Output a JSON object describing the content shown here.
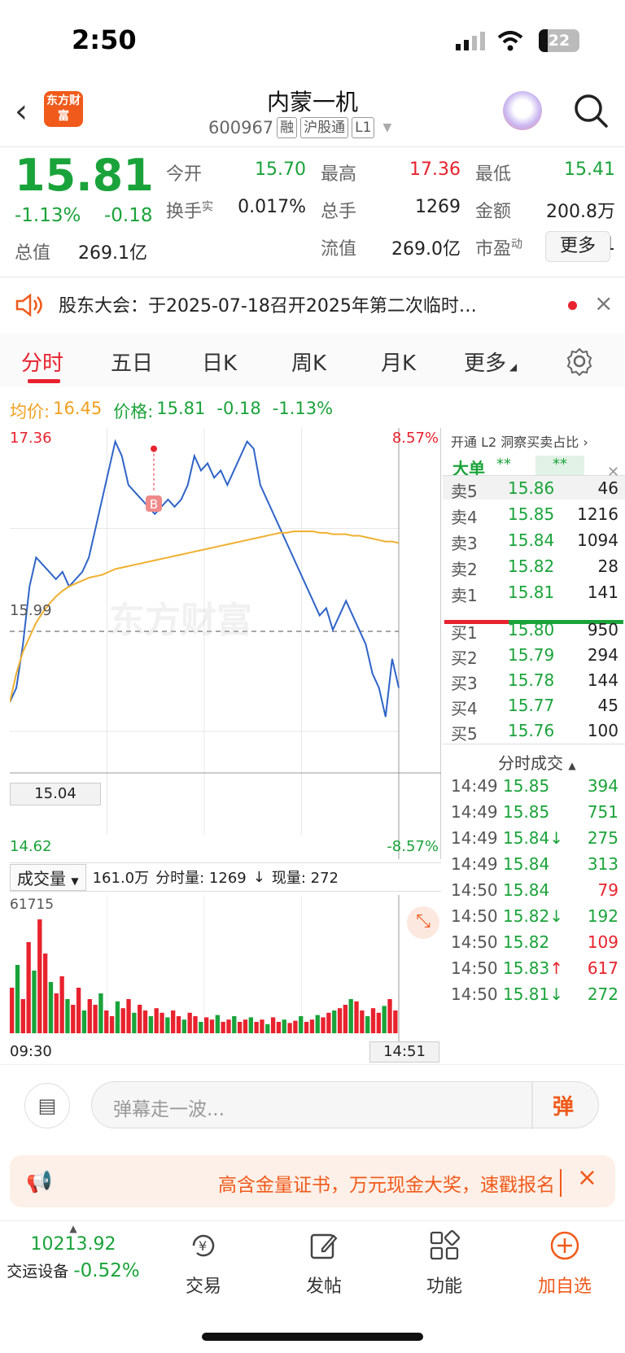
{
  "status_bar": {
    "time": "2:50",
    "battery": "22"
  },
  "header": {
    "logo_text": "东方财富",
    "title": "内蒙一机",
    "code": "600967",
    "tags": [
      "融",
      "沪股通",
      "L1"
    ]
  },
  "quote": {
    "price": "15.81",
    "change_pct": "-1.13%",
    "change": "-0.18",
    "fields": [
      {
        "label": "今开",
        "value": "15.70",
        "color": "green"
      },
      {
        "label": "最高",
        "value": "17.36",
        "color": "red"
      },
      {
        "label": "最低",
        "value": "15.41",
        "color": "green"
      },
      {
        "label": "换手",
        "sup": "实",
        "value": "0.017%",
        "color": "black"
      },
      {
        "label": "总手",
        "value": "1269",
        "color": "black"
      },
      {
        "label": "金额",
        "value": "200.8万",
        "color": "black"
      },
      {
        "label": "总值",
        "value": "269.1亿",
        "color": "black"
      },
      {
        "label": "流值",
        "value": "269.0亿",
        "color": "black"
      },
      {
        "label": "市盈",
        "sup": "动",
        "value": "36.11",
        "color": "black"
      }
    ],
    "more_label": "更多"
  },
  "notice": {
    "text": "股东大会：于2025-07-18召开2025年第二次临时…"
  },
  "tabs": [
    {
      "label": "分时",
      "active": true
    },
    {
      "label": "五日"
    },
    {
      "label": "日K"
    },
    {
      "label": "周K"
    },
    {
      "label": "月K"
    },
    {
      "label": "更多"
    }
  ],
  "avg_line": {
    "avg_label": "均价:",
    "avg_value": "16.45",
    "price_label": "价格:",
    "price_value": "15.81",
    "change": "-0.18",
    "change_pct": "-1.13%"
  },
  "chart_data": {
    "type": "line",
    "y_high": "17.36",
    "y_low": "14.62",
    "y_ref": "15.99",
    "pct_high": "8.57%",
    "pct_low": "-8.57%",
    "level_label": "15.04",
    "ylim": [
      14.62,
      17.36
    ],
    "watermark": "东方财富",
    "marker": "B",
    "x_start": "09:30",
    "x_end": "14:51",
    "series": [
      {
        "values": [
          15.5,
          15.6,
          15.9,
          16.3,
          16.5,
          16.45,
          16.4,
          16.35,
          16.4,
          16.3,
          16.35,
          16.4,
          16.5,
          16.7,
          16.9,
          17.1,
          17.3,
          17.2,
          17.0,
          16.95,
          16.9,
          16.85,
          16.8,
          16.85,
          16.9,
          16.85,
          16.9,
          17.0,
          17.2,
          17.1,
          17.15,
          17.05,
          17.1,
          17.0,
          17.1,
          17.2,
          17.3,
          17.25,
          17.0,
          16.9,
          16.8,
          16.7,
          16.6,
          16.5,
          16.4,
          16.3,
          16.2,
          16.1,
          16.15,
          16.0,
          16.1,
          16.2,
          16.1,
          16.0,
          15.9,
          15.7,
          15.6,
          15.4,
          15.8,
          15.6
        ]
      },
      {
        "values": [
          15.5,
          15.7,
          15.85,
          15.95,
          16.05,
          16.12,
          16.18,
          16.23,
          16.27,
          16.3,
          16.32,
          16.34,
          16.36,
          16.37,
          16.38,
          16.4,
          16.42,
          16.43,
          16.44,
          16.45,
          16.46,
          16.47,
          16.48,
          16.49,
          16.5,
          16.51,
          16.52,
          16.53,
          16.54,
          16.55,
          16.56,
          16.57,
          16.58,
          16.59,
          16.6,
          16.61,
          16.62,
          16.63,
          16.64,
          16.65,
          16.66,
          16.67,
          16.67,
          16.68,
          16.68,
          16.68,
          16.68,
          16.67,
          16.67,
          16.66,
          16.66,
          16.66,
          16.65,
          16.65,
          16.64,
          16.63,
          16.62,
          16.61,
          16.61,
          16.6
        ]
      }
    ],
    "volume": {
      "label": "成交量",
      "total": "161.0万",
      "fen_label": "分时量: 1269",
      "now_label": "现量: 272",
      "max": "61715",
      "values": [
        40,
        60,
        30,
        80,
        55,
        100,
        70,
        45,
        35,
        50,
        30,
        25,
        40,
        20,
        30,
        25,
        35,
        20,
        15,
        28,
        22,
        30,
        18,
        25,
        20,
        15,
        22,
        18,
        14,
        20,
        15,
        12,
        18,
        15,
        10,
        14,
        12,
        16,
        10,
        12,
        15,
        10,
        12,
        14,
        10,
        12,
        8,
        14,
        10,
        12,
        9,
        11,
        15,
        10,
        12,
        16,
        14,
        18,
        20,
        22,
        25,
        30,
        28,
        20,
        15,
        22,
        18,
        24,
        30,
        20
      ]
    }
  },
  "order_book": {
    "l2_tip": "开通 L2 洞察买卖占比",
    "big_order_label": "大单",
    "big_order_value_1": "**",
    "big_order_value_2": "**",
    "asks": [
      {
        "label": "卖5",
        "price": "15.86",
        "vol": "46"
      },
      {
        "label": "卖4",
        "price": "15.85",
        "vol": "1216"
      },
      {
        "label": "卖3",
        "price": "15.84",
        "vol": "1094"
      },
      {
        "label": "卖2",
        "price": "15.82",
        "vol": "28"
      },
      {
        "label": "卖1",
        "price": "15.81",
        "vol": "141"
      }
    ],
    "bids": [
      {
        "label": "买1",
        "price": "15.80",
        "vol": "950"
      },
      {
        "label": "买2",
        "price": "15.79",
        "vol": "294"
      },
      {
        "label": "买3",
        "price": "15.78",
        "vol": "144"
      },
      {
        "label": "买4",
        "price": "15.77",
        "vol": "45"
      },
      {
        "label": "买5",
        "price": "15.76",
        "vol": "100"
      }
    ],
    "ticks_title": "分时成交",
    "ticks": [
      {
        "time": "14:49",
        "price": "15.85",
        "vol": "394",
        "dir": "",
        "color": "green"
      },
      {
        "time": "14:49",
        "price": "15.85",
        "vol": "751",
        "dir": "",
        "color": "green"
      },
      {
        "time": "14:49",
        "price": "15.84",
        "vol": "275",
        "dir": "↓",
        "color": "green"
      },
      {
        "time": "14:49",
        "price": "15.84",
        "vol": "313",
        "dir": "",
        "color": "green"
      },
      {
        "time": "14:50",
        "price": "15.84",
        "vol": "79",
        "dir": "",
        "color": "red"
      },
      {
        "time": "14:50",
        "price": "15.82",
        "vol": "192",
        "dir": "↓",
        "color": "green"
      },
      {
        "time": "14:50",
        "price": "15.82",
        "vol": "109",
        "dir": "",
        "color": "red"
      },
      {
        "time": "14:50",
        "price": "15.83",
        "vol": "617",
        "dir": "↑",
        "color": "red"
      },
      {
        "time": "14:50",
        "price": "15.81",
        "vol": "272",
        "dir": "↓",
        "color": "green"
      }
    ]
  },
  "comment": {
    "placeholder": "弹幕走一波...",
    "danmu_label": "弹"
  },
  "banner": {
    "text": "高含金量证书，万元现金大奖，速戳报名"
  },
  "bottom_nav": {
    "index_value": "10213.92",
    "index_name": "交运设备",
    "index_change": "-0.52%",
    "items": [
      "交易",
      "发帖",
      "功能",
      "加自选"
    ]
  }
}
